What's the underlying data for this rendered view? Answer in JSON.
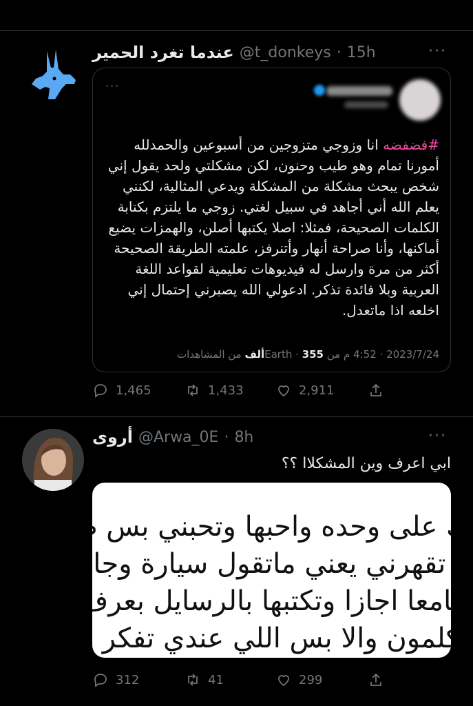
{
  "tweet1": {
    "display_name": "عندما تغرد الحمير",
    "handle": "@t_donkeys",
    "separator": "·",
    "time": "15h",
    "more": "···",
    "quote": {
      "dots": "···",
      "hashtag": "#فضفضه",
      "body": " انا وزوجي متزوجين من أسبوعين والحمدلله أمورنا تمام وهو طيب وحنون، لكن مشكلتي ولحد يقول إني شخص يبحث مشكلة من المشكلة ويدعي المثالية، لكنني يعلم الله أني أجاهد في سبيل لغتي. زوجي ما يلتزم بكتابة الكلمات الصحيحة، فمثلا: اصلا يكتبها أصلن، والهمزات يضيع أماكنها، وأنا صراحة أنهار وأتنرفز، علمته الطريقة الصحيحة أكثر من مرة وارسل له فيديوهات تعليمية لقواعد اللغة العربية وبلا فائدة تذكر. ادعولي الله يصبرني إحتمال إني اخلعه اذا ماتعدل.",
      "meta_date": "2023/7/24",
      "meta_time": "4:52 م",
      "meta_source": "من Earth",
      "meta_views_count": "355ألف",
      "meta_views_label": "من المشاهدات"
    },
    "stats": {
      "replies": "1,465",
      "retweets": "1,433",
      "likes": "2,911"
    }
  },
  "tweet2": {
    "display_name": "أروى",
    "handle": "@Arwa_0E",
    "separator": "·",
    "time": "8h",
    "more": "···",
    "text": "ابي اعرف وين المشكلاا ؟؟",
    "media_lines": [
      "ك على وحده واحبها وتحبني بس ط",
      "ه تقهرني يعني ماتقول سيارة وجامع",
      "جامعا اجازا وتكتبها بالرسايل بعرف ك",
      "تكلمون والا بس اللي عندي تفكر هال"
    ],
    "stats": {
      "replies": "312",
      "retweets": "41",
      "likes": "299"
    }
  }
}
